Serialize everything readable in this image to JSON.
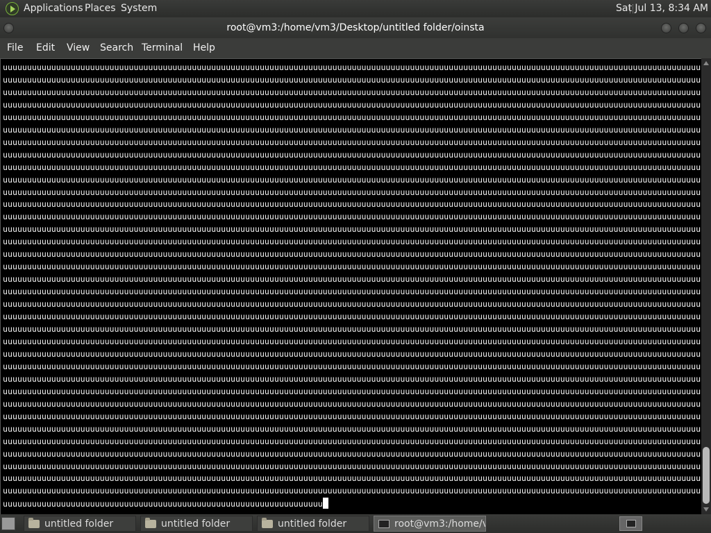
{
  "top_panel": {
    "menus": [
      "Applications",
      "Places",
      "System"
    ],
    "clock": "Sat Jul 13,  8:34 AM"
  },
  "window": {
    "title": "root@vm3:/home/vm3/Desktop/untitled folder/oinsta"
  },
  "menubar": [
    "File",
    "Edit",
    "View",
    "Search",
    "Terminal",
    "Help"
  ],
  "terminal": {
    "fill_char": "u",
    "full_lines": 35,
    "chars_per_full_line": 160,
    "last_line_chars": 66
  },
  "taskbar": {
    "tasks": [
      {
        "label": "untitled folder",
        "icon": "folder-icon"
      },
      {
        "label": "untitled folder",
        "icon": "folder-icon"
      },
      {
        "label": "untitled folder",
        "icon": "folder-icon"
      },
      {
        "label": "root@vm3:/home/v...",
        "icon": "terminal-icon"
      }
    ]
  }
}
